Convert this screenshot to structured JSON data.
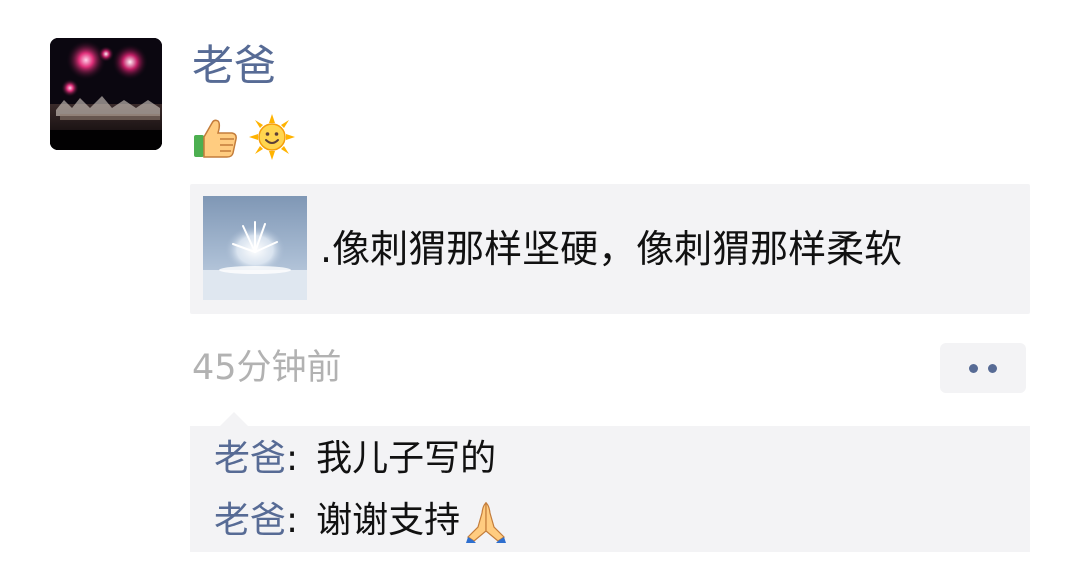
{
  "post": {
    "author": "老爸",
    "status_emojis": [
      "thumbs-up-icon",
      "sun-icon"
    ],
    "link": {
      "thumbnail": "snowy-splash-image",
      "title": ".像刺猬那样坚硬，像刺猬那样柔软"
    },
    "time": "45分钟前",
    "more_icon": "more-dots-icon"
  },
  "comments": [
    {
      "author": "老爸",
      "separator": ":",
      "text": "我儿子写的",
      "emoji": ""
    },
    {
      "author": "老爸",
      "separator": ":",
      "text": "谢谢支持",
      "emoji": "folded-hands-icon"
    }
  ],
  "colors": {
    "name_link": "#576b95",
    "card_bg": "#f3f3f5",
    "time_text": "#b2b2b2",
    "body_text": "#111111"
  }
}
